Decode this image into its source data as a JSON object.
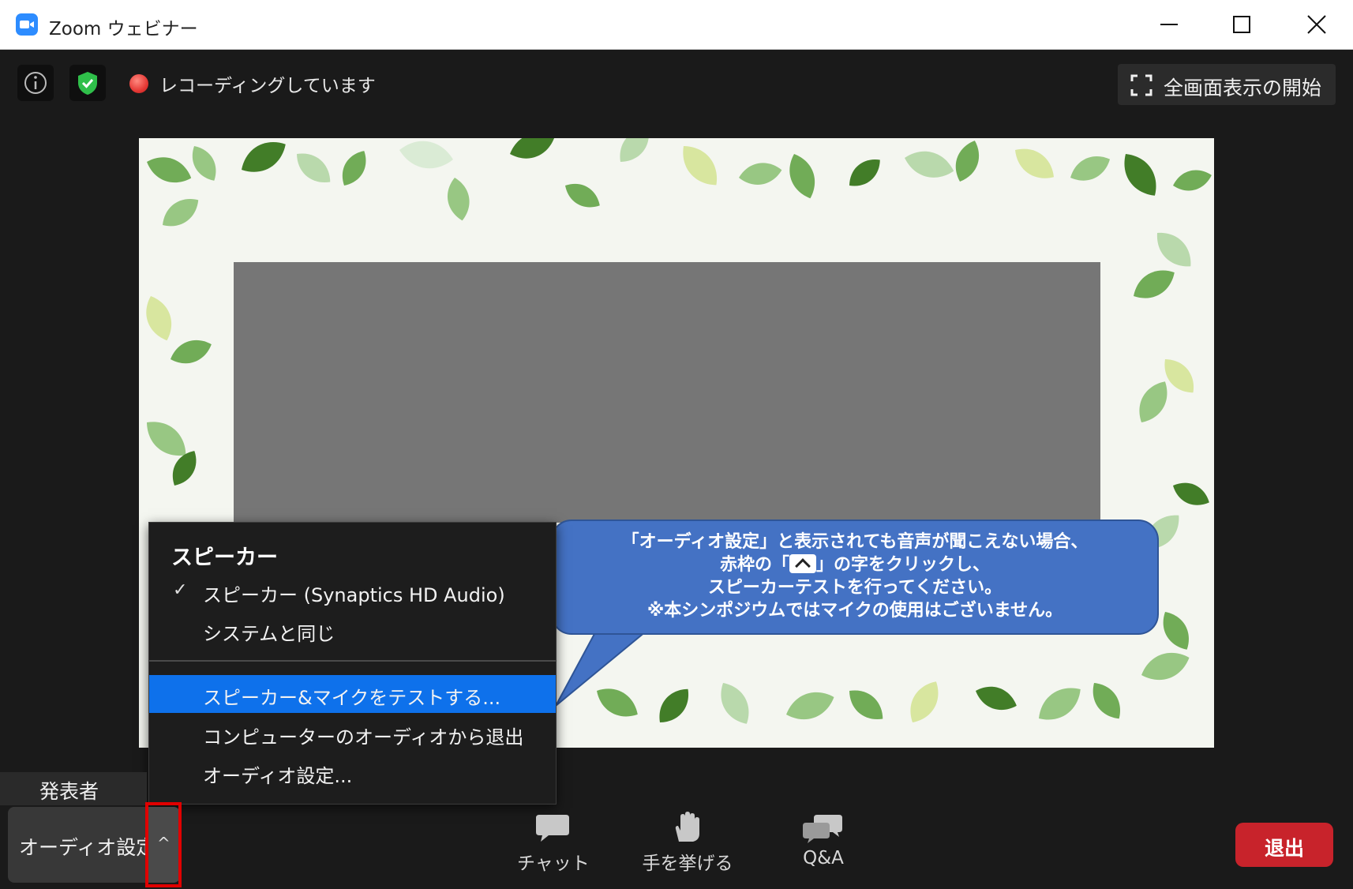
{
  "window": {
    "title": "Zoom ウェビナー"
  },
  "topbar": {
    "recording_text": "レコーディングしています",
    "fullscreen_label": "全画面表示の開始"
  },
  "audio_menu": {
    "heading": "スピーカー",
    "items": [
      {
        "label": "スピーカー (Synaptics HD Audio)",
        "checked": true
      },
      {
        "label": "システムと同じ",
        "checked": false
      },
      {
        "label": "スピーカー&マイクをテストする...",
        "highlighted": true
      },
      {
        "label": "コンピューターのオーディオから退出"
      },
      {
        "label": "オーディオ設定..."
      }
    ]
  },
  "callout": {
    "line1": "「オーディオ設定」と表示されても音声が聞こえない場合、",
    "line2_before": "赤枠の「",
    "line2_after": "」の字をクリックし、",
    "line3": "スピーカーテストを行ってください。",
    "line4": "※本シンポジウムではマイクの使用はございません。"
  },
  "bottombar": {
    "presenter_label": "発表者",
    "audio_settings_label": "オーディオ設定",
    "audio_caret": "^",
    "chat_label": "チャット",
    "raise_hand_label": "手を挙げる",
    "qa_label": "Q&A",
    "leave_label": "退出"
  },
  "colors": {
    "menu_highlight": "#0e71eb",
    "callout": "#4472c4",
    "leave": "#c8232b",
    "annotation_frame": "#e00000"
  }
}
